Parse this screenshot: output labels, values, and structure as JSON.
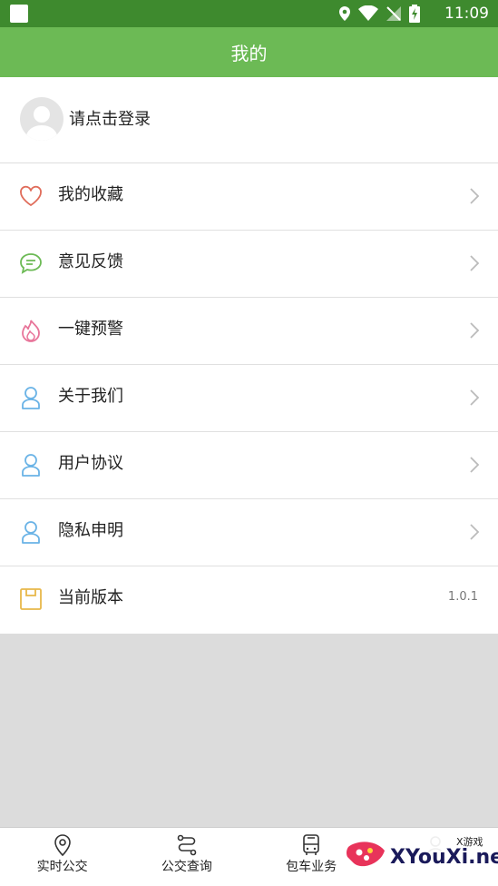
{
  "status_bar": {
    "time": "11:09"
  },
  "header": {
    "title": "我的"
  },
  "profile": {
    "login_text": "请点击登录"
  },
  "menu": {
    "items": [
      {
        "label": "我的收藏",
        "icon": "heart-icon",
        "color": "#e06c5a"
      },
      {
        "label": "意见反馈",
        "icon": "chat-icon",
        "color": "#6cba55"
      },
      {
        "label": "一键预警",
        "icon": "flame-icon",
        "color": "#e8759a"
      },
      {
        "label": "关于我们",
        "icon": "user-icon",
        "color": "#6ab3e6"
      },
      {
        "label": "用户协议",
        "icon": "user-icon",
        "color": "#6ab3e6"
      },
      {
        "label": "隐私申明",
        "icon": "user-icon",
        "color": "#6ab3e6"
      },
      {
        "label": "当前版本",
        "icon": "version-icon",
        "color": "#e8b84a",
        "value": "1.0.1"
      }
    ]
  },
  "tabbar": {
    "tabs": [
      {
        "label": "实时公交",
        "icon": "location-pin-icon"
      },
      {
        "label": "公交查询",
        "icon": "route-icon"
      },
      {
        "label": "包车业务",
        "icon": "bus-icon"
      },
      {
        "label": "",
        "icon": "user-icon"
      }
    ]
  },
  "watermark": {
    "text": "XYouXi.net",
    "small": "X游戏"
  }
}
